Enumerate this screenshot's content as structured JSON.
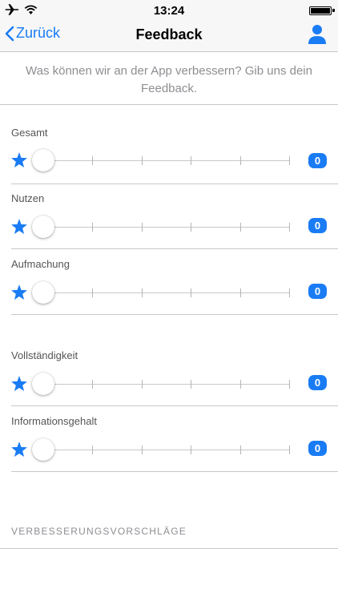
{
  "status_bar": {
    "time": "13:24"
  },
  "nav": {
    "back_label": "Zurück",
    "title": "Feedback"
  },
  "intro_text": "Was können wir an der App verbessern? Gib uns dein Feedback.",
  "ratings": [
    {
      "label": "Gesamt",
      "value": "0"
    },
    {
      "label": "Nutzen",
      "value": "0"
    },
    {
      "label": "Aufmachung",
      "value": "0"
    },
    {
      "label": "Vollständigkeit",
      "value": "0"
    },
    {
      "label": "Informationsgehalt",
      "value": "0"
    }
  ],
  "suggestions_header": "VERBESSERUNGSVORSCHLÄGE",
  "colors": {
    "accent": "#1a7cf4",
    "separator": "#c8c7cc",
    "secondary_text": "#8e8e93"
  }
}
